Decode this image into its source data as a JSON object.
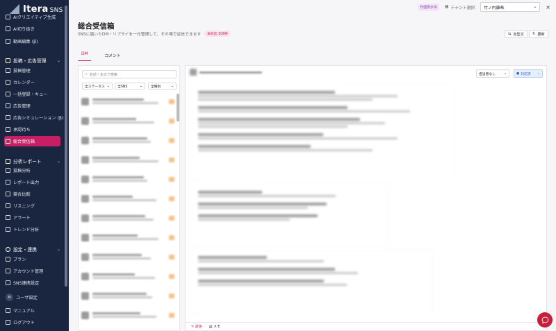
{
  "app": {
    "name": "Itera",
    "suffix": "SNS"
  },
  "topbar": {
    "proxy_badge": "代理表示中",
    "tenant_label": "テナント選択",
    "tenant_value": "竹ノ内康希",
    "close": "×"
  },
  "sidebar": {
    "items_top": [
      {
        "label": "AIクリエイティブ生成"
      },
      {
        "label": "AI切り抜き"
      },
      {
        "label": "動画編集 (β)"
      }
    ],
    "section_posts": "投稿・広告管理",
    "items_posts": [
      {
        "label": "投稿管理"
      },
      {
        "label": "カレンダー"
      },
      {
        "label": "一括登録・キュー"
      },
      {
        "label": "広告管理"
      },
      {
        "label": "広告シミュレーション (β)"
      },
      {
        "label": "承認待ち"
      },
      {
        "label": "総合受信箱"
      }
    ],
    "section_reports": "分析レポート",
    "items_reports": [
      {
        "label": "投稿分析"
      },
      {
        "label": "レポート出力"
      },
      {
        "label": "競合比較"
      },
      {
        "label": "リスニング"
      },
      {
        "label": "アラート"
      },
      {
        "label": "トレンド分析"
      }
    ],
    "section_settings": "設定・連携",
    "items_settings": [
      {
        "label": "プラン"
      },
      {
        "label": "アカウント管理"
      },
      {
        "label": "SNS連携設定"
      }
    ],
    "user_initial": "M",
    "user_label": "ユーザ設定",
    "manual": "マニュアル",
    "logout": "ログアウト"
  },
  "page": {
    "title": "総合受信箱",
    "subtitle": "SNSに届いたDM・リプライを一元管理して、その場で返信できます",
    "unread_pill": "未対応 108件",
    "btn_template": "定型文",
    "btn_refresh": "更新",
    "tabs": [
      "DM",
      "コメント"
    ]
  },
  "list": {
    "search_placeholder": "名前・本文で検索",
    "filter_status": "全ステータス",
    "filter_sns": "全SNS",
    "filter_type": "全種別"
  },
  "conversation": {
    "assignee": "担当者なし",
    "status": "対応済"
  },
  "reply": {
    "tab_reply": "返信",
    "tab_note": "メモ"
  },
  "colors": {
    "sidebar": "#1a2540",
    "accent": "#c81e63",
    "fab": "#c81e3c"
  }
}
